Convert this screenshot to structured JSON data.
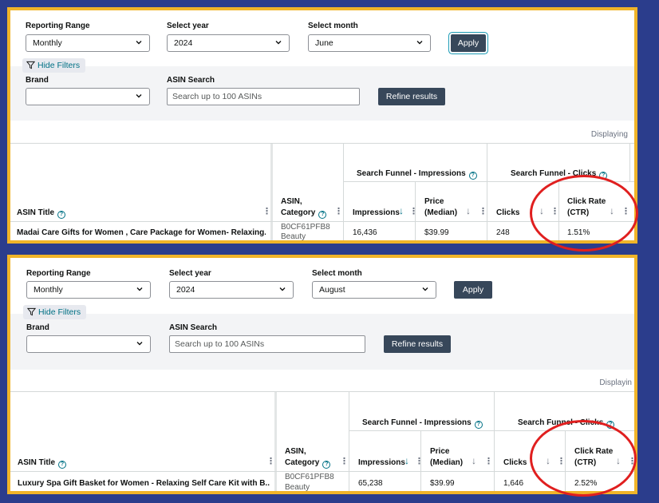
{
  "panels": [
    {
      "filters": {
        "reporting_range_label": "Reporting Range",
        "reporting_range_value": "Monthly",
        "year_label": "Select year",
        "year_value": "2024",
        "month_label": "Select month",
        "month_value": "June",
        "apply_label": "Apply",
        "hide_filters_label": "Hide Filters",
        "brand_label": "Brand",
        "brand_value": "",
        "asin_search_label": "ASIN Search",
        "asin_search_placeholder": "Search up to 100 ASINs",
        "refine_label": "Refine results"
      },
      "displaying_text": "Displaying",
      "table": {
        "group_impressions": "Search Funnel - Impressions",
        "group_clicks": "Search Funnel - Clicks",
        "col_asin_title": "ASIN Title",
        "col_asin": "ASIN,",
        "col_category": "Category",
        "col_impressions": "Impressions",
        "col_price_1": "Price",
        "col_price_2": "(Median)",
        "col_clicks": "Clicks",
        "col_ctr_1": "Click Rate",
        "col_ctr_2": "(CTR)",
        "row": {
          "title": "Madai Care Gifts for Women , Care Package for Women- Relaxing...",
          "asin": "B0CF61PFB8",
          "category": "Beauty",
          "impressions": "16,436",
          "price": "$39.99",
          "clicks": "248",
          "ctr": "1.51%"
        }
      }
    },
    {
      "filters": {
        "reporting_range_label": "Reporting Range",
        "reporting_range_value": "Monthly",
        "year_label": "Select year",
        "year_value": "2024",
        "month_label": "Select month",
        "month_value": "August",
        "apply_label": "Apply",
        "hide_filters_label": "Hide Filters",
        "brand_label": "Brand",
        "brand_value": "",
        "asin_search_label": "ASIN Search",
        "asin_search_placeholder": "Search up to 100 ASINs",
        "refine_label": "Refine results"
      },
      "displaying_text": "Displayin",
      "table": {
        "group_impressions": "Search Funnel - Impressions",
        "group_clicks": "Search Funnel - Clicks",
        "col_asin_title": "ASIN Title",
        "col_asin": "ASIN,",
        "col_category": "Category",
        "col_impressions": "Impressions",
        "col_price_1": "Price",
        "col_price_2": "(Median)",
        "col_clicks": "Clicks",
        "col_ctr_1": "Click Rate",
        "col_ctr_2": "(CTR)",
        "row": {
          "title": "Luxury Spa Gift Basket for Women - Relaxing Self Care Kit with B...",
          "asin": "B0CF61PFB8",
          "category": "Beauty",
          "impressions": "65,238",
          "price": "$39.99",
          "clicks": "1,646",
          "ctr": "2.52%"
        }
      }
    }
  ],
  "icons": {
    "help": "help-circle-icon",
    "filter": "filter-icon",
    "chevron": "chevron-down-icon",
    "sort": "sort-arrow-icon",
    "kebab": "column-menu-icon"
  },
  "colors": {
    "background": "#2b3d8c",
    "panel_border": "#f0b429",
    "highlight_ellipse": "#e01f1f",
    "link": "#007185",
    "button_dark": "#37475a"
  }
}
